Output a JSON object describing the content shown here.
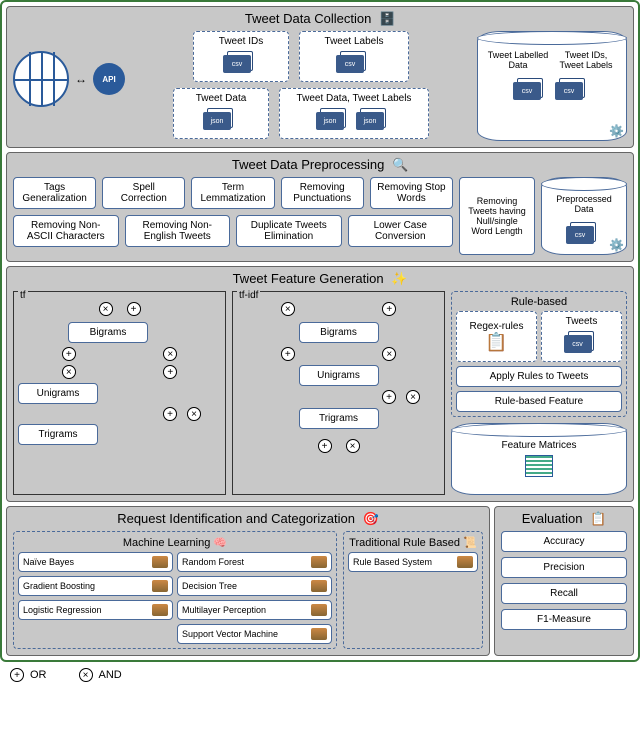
{
  "sections": {
    "collection": {
      "title": "Tweet Data Collection",
      "globe_label": "",
      "api_label": "API",
      "boxes": {
        "tweet_ids": "Tweet IDs",
        "tweet_labels": "Tweet Labels",
        "tweet_data": "Tweet Data",
        "tweet_data_labels": "Tweet Data, Tweet Labels"
      },
      "db": {
        "left_label": "Tweet Labelled Data",
        "right_label": "Tweet IDs, Tweet Labels"
      }
    },
    "preprocessing": {
      "title": "Tweet Data Preprocessing",
      "items": [
        "Tags Generalization",
        "Spell Correction",
        "Term Lemmatization",
        "Removing Punctuations",
        "Removing Stop Words",
        "Removing Non-ASCII Characters",
        "Removing Non-English Tweets",
        "Duplicate Tweets Elimination",
        "Lower Case Conversion"
      ],
      "tall_item": "Removing Tweets having Null/single Word Length",
      "db_label": "Preprocessed Data"
    },
    "feature": {
      "title": "Tweet Feature Generation",
      "tf_label": "tf",
      "tfidf_label": "tf-idf",
      "ngrams": {
        "unigrams": "Unigrams",
        "bigrams": "Bigrams",
        "trigrams": "Trigrams"
      },
      "rulebased": {
        "title": "Rule-based",
        "regex": "Regex-rules",
        "tweets": "Tweets",
        "apply": "Apply Rules to Tweets",
        "feature": "Rule-based Feature"
      },
      "matrices_label": "Feature Matrices"
    },
    "identification": {
      "title": "Request Identification and Categorization",
      "ml_title": "Machine Learning",
      "ml_items": [
        "Naïve Bayes",
        "Random Forest",
        "Gradient Boosting",
        "Decision Tree",
        "Logistic Regression",
        "Multilayer Perception",
        "Support Vector Machine"
      ],
      "trad_title": "Traditional Rule Based",
      "trad_item": "Rule Based System"
    },
    "evaluation": {
      "title": "Evaluation",
      "metrics": [
        "Accuracy",
        "Precision",
        "Recall",
        "F1-Measure"
      ]
    }
  },
  "legend": {
    "or": "OR",
    "and": "AND"
  }
}
